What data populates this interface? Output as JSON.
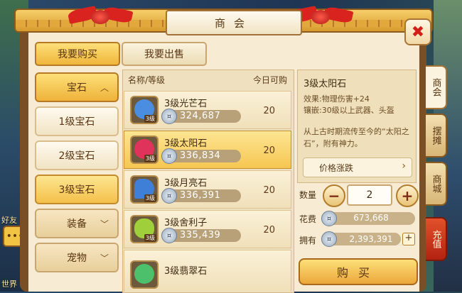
{
  "window": {
    "title": "商会",
    "close_label": "✖"
  },
  "top_tabs": [
    {
      "label": "我要购买",
      "active": true
    },
    {
      "label": "我要出售",
      "active": false
    }
  ],
  "side": {
    "chat_icon": "chat-bubble-icon",
    "label_top": "好友",
    "label_bottom": "世界"
  },
  "categories": {
    "gem_header": "宝石",
    "gem_items": [
      "1级宝石",
      "2级宝石",
      "3级宝石"
    ],
    "equip": "装备",
    "pet": "宠物"
  },
  "list": {
    "header_name": "名称/等级",
    "header_qty": "今日可购",
    "level_badge": "3级",
    "items": [
      {
        "name": "3级光芒石",
        "price": "324,687",
        "qty": "20",
        "color": "#4b8de0"
      },
      {
        "name": "3级太阳石",
        "price": "336,834",
        "qty": "20",
        "color": "#e0335c"
      },
      {
        "name": "3级月亮石",
        "price": "336,391",
        "qty": "20",
        "color": "#3f7fd8"
      },
      {
        "name": "3级舍利子",
        "price": "335,439",
        "qty": "20",
        "color": "#9fd03c"
      },
      {
        "name": "3级翡翠石",
        "price": "",
        "qty": "",
        "color": "#4cc06a"
      }
    ]
  },
  "detail": {
    "name": "3级太阳石",
    "effect": "效果:物理伤害+24",
    "inlay": "镶嵌:30级以上武器、头盔",
    "description": "从上古时期流传至今的“太阳之石”，附有神力。",
    "trend_label": "价格涨跌",
    "quantity_label": "数量",
    "quantity": "2",
    "cost_label": "花费",
    "cost": "673,668",
    "owned_label": "拥有",
    "owned": "2,393,391",
    "buy_label": "购买"
  },
  "side_tabs": [
    "商会",
    "摆摊",
    "商城",
    "充值"
  ]
}
